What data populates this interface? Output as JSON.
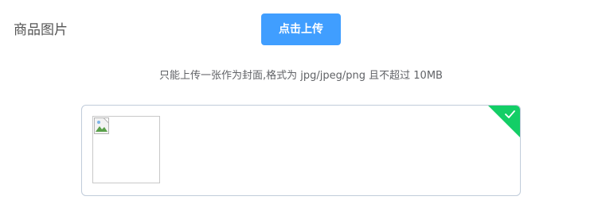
{
  "form": {
    "label": "商品图片",
    "upload_button": "点击上传",
    "tip": "只能上传一张作为封面,格式为 jpg/jpeg/png 且不超过 10MB"
  },
  "file_list": {
    "items": [
      {
        "status": "success",
        "status_icon": "check-icon",
        "thumbnail": "broken-image-icon"
      }
    ]
  },
  "colors": {
    "primary": "#409eff",
    "success": "#13ce66",
    "border": "#c0ccda",
    "text": "#606266"
  }
}
